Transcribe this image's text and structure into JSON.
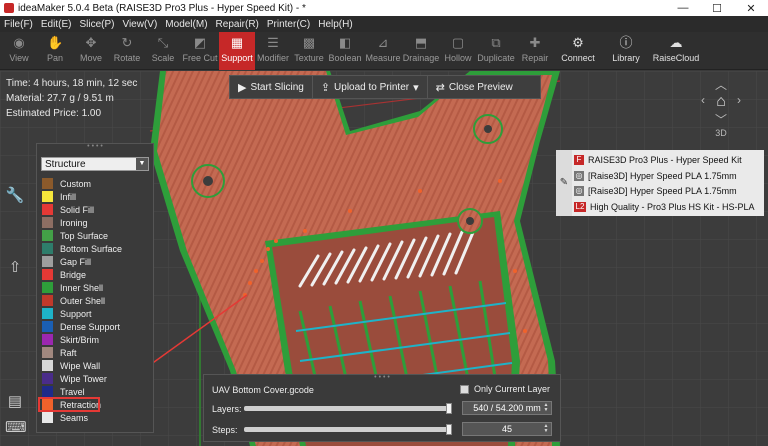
{
  "window": {
    "title": "ideaMaker 5.0.4 Beta (RAISE3D Pro3 Plus - Hyper Speed Kit) - *",
    "minimize": "—",
    "maximize": "☐",
    "close": "✕"
  },
  "menu": [
    "File(F)",
    "Edit(E)",
    "Slice(P)",
    "View(V)",
    "Model(M)",
    "Repair(R)",
    "Printer(C)",
    "Help(H)"
  ],
  "toolbar": {
    "items": [
      {
        "label": "View",
        "icon": "eye-icon"
      },
      {
        "label": "Pan",
        "icon": "hand-icon"
      },
      {
        "label": "Move",
        "icon": "move-icon"
      },
      {
        "label": "Rotate",
        "icon": "rotate-icon"
      },
      {
        "label": "Scale",
        "icon": "scale-icon"
      },
      {
        "label": "Free Cut",
        "icon": "cut-icon"
      },
      {
        "label": "Support",
        "icon": "support-icon"
      },
      {
        "label": "Modifier",
        "icon": "modifier-icon"
      },
      {
        "label": "Texture",
        "icon": "texture-icon"
      },
      {
        "label": "Boolean",
        "icon": "boolean-icon"
      },
      {
        "label": "Measure",
        "icon": "measure-icon"
      },
      {
        "label": "Drainage",
        "icon": "drainage-icon"
      },
      {
        "label": "Hollow",
        "icon": "hollow-icon"
      },
      {
        "label": "Duplicate",
        "icon": "duplicate-icon"
      },
      {
        "label": "Repair",
        "icon": "repair-icon"
      },
      {
        "label": "Connect",
        "icon": "connect-icon"
      },
      {
        "label": "Library",
        "icon": "library-icon"
      },
      {
        "label": "RaiseCloud",
        "icon": "cloud-icon"
      }
    ]
  },
  "info": {
    "time": "Time: 4 hours, 18 min, 12 sec",
    "material": "Material: 27.7 g / 9.51 m",
    "price": "Estimated Price: 1.00"
  },
  "actions": {
    "start_slicing": "Start Slicing",
    "upload": "Upload to Printer",
    "close_preview": "Close Preview"
  },
  "legend": {
    "selected": "Structure",
    "items": [
      {
        "label": "Custom",
        "color": "#8b5a2b"
      },
      {
        "label": "Infill",
        "color": "#f5e63b"
      },
      {
        "label": "Solid Fill",
        "color": "#e53935"
      },
      {
        "label": "Ironing",
        "color": "#8d6e63"
      },
      {
        "label": "Top Surface",
        "color": "#43a047"
      },
      {
        "label": "Bottom Surface",
        "color": "#2e7d6b"
      },
      {
        "label": "Gap Fill",
        "color": "#9e9e9e"
      },
      {
        "label": "Bridge",
        "color": "#e53935"
      },
      {
        "label": "Inner Shell",
        "color": "#2e9e3a"
      },
      {
        "label": "Outer Shell",
        "color": "#c0392b"
      },
      {
        "label": "Support",
        "color": "#1eb3c8"
      },
      {
        "label": "Dense Support",
        "color": "#1a5fb4"
      },
      {
        "label": "Skirt/Brim",
        "color": "#9c27b0"
      },
      {
        "label": "Raft",
        "color": "#a1887f"
      },
      {
        "label": "Wipe Wall",
        "color": "#d8d8d8"
      },
      {
        "label": "Wipe Tower",
        "color": "#4a2c8a"
      },
      {
        "label": "Travel",
        "color": "#1e2a8a"
      },
      {
        "label": "Retraction",
        "color": "#f0622b"
      },
      {
        "label": "Seams",
        "color": "#e8e8e8"
      }
    ]
  },
  "profile": {
    "rows": [
      {
        "text": "RAISE3D Pro3 Plus - Hyper Speed Kit",
        "icon": "printer-icon",
        "color": "#c62828"
      },
      {
        "text": "[Raise3D] Hyper Speed PLA 1.75mm",
        "icon": "filament-icon",
        "color": "#777777"
      },
      {
        "text": "[Raise3D] Hyper Speed PLA 1.75mm",
        "icon": "filament-icon",
        "color": "#777777"
      },
      {
        "text": "High Quality - Pro3 Plus HS Kit - HS-PLA",
        "icon": "quality-icon",
        "color": "#c62828",
        "badge": "L2"
      }
    ]
  },
  "gcode": {
    "filename": "UAV Bottom Cover.gcode",
    "only_current_layer": "Only Current Layer",
    "layers_label": "Layers:",
    "layers_value": "540 / 54.200 mm",
    "steps_label": "Steps:",
    "steps_value": "45",
    "layers_progress": 1.0,
    "steps_progress": 1.0
  },
  "navcube": {
    "label": "3D"
  }
}
